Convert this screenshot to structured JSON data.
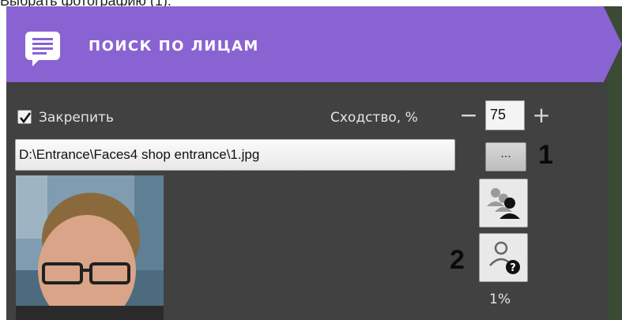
{
  "document_caption": "Выбрать фотографию (1).",
  "panel": {
    "title": "ПОИСК ПО ЛИЦАМ",
    "header_color": "#8a63d2",
    "header_icon": "chat-bubble-icon"
  },
  "controls": {
    "pin_label": "Закрепить",
    "pin_checked": true,
    "similarity_label": "Сходство, %",
    "minus_label": "−",
    "similarity_value": "75",
    "plus_label": "+",
    "file_path": "D:\\Entrance\\Faces4 shop entrance\\1.jpg",
    "browse_label": "...",
    "group_search_icon": "group-people-icon",
    "unknown_person_icon": "person-question-icon",
    "match_percent": "1%"
  },
  "callouts": {
    "one": "1",
    "two": "2"
  }
}
